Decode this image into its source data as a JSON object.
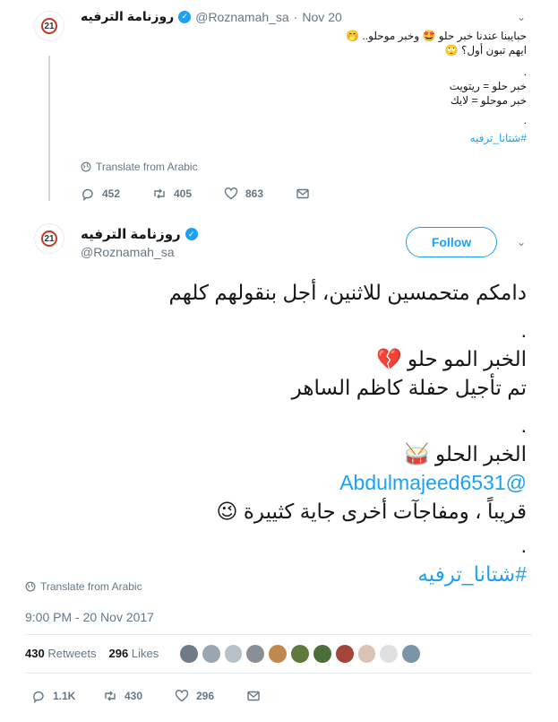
{
  "tweet1": {
    "name": "روزنامة الترفيه",
    "handle": "@Roznamah_sa",
    "dot": "·",
    "date": "Nov 20",
    "line1": "حبايبنا عندنا خبر حلو 🤩 وخبر موحلو.. 🤭",
    "line2": "ايهم تبون أول؟ 🙄",
    "line3": ".",
    "line4": "خبر حلو = ريتويت",
    "line5": "خبر موحلو = لايك",
    "line6": ".",
    "hashtag": "#شتانا_ترفيه",
    "translate": "Translate from Arabic",
    "replies": "452",
    "retweets": "405",
    "likes": "863"
  },
  "tweet2": {
    "name": "روزنامة الترفيه",
    "handle": "@Roznamah_sa",
    "follow_label": "Follow",
    "lines": [
      "دامكم متحمسين للاثنين، أجل بنقولهم كلهم",
      ".",
      "الخبر المو حلو 💔",
      "تم تأجيل حفلة كاظم الساهر",
      ".",
      "الخبر الحلو 🥁",
      "@Abdulmajeed6531",
      "قريباً ، ومفاجآت أخرى جاية كثييرة 😉",
      ".",
      "#شتانا_ترفيه"
    ],
    "translate": "Translate from Arabic",
    "timestamp": "9:00 PM - 20 Nov 2017",
    "retweets_count": "430",
    "retweets_label": "Retweets",
    "likes_count": "296",
    "likes_label": "Likes",
    "replies": "1.1K",
    "retweets": "430",
    "likes": "296"
  },
  "avatar": {
    "number": "21",
    "caption": "روزنامة الترفيه"
  },
  "colors": {
    "accent": "#1da1f2",
    "muted": "#657786",
    "text": "#14171a",
    "border": "#e6ecf0"
  },
  "likers_colors": [
    "#6f7b86",
    "#9aa7b3",
    "#b8c0c8",
    "#8a8f95",
    "#c2874f",
    "#5d7a3a",
    "#4b6e3b",
    "#a4453a",
    "#d8c3b5",
    "#e0dfe2",
    "#7a95a6"
  ]
}
